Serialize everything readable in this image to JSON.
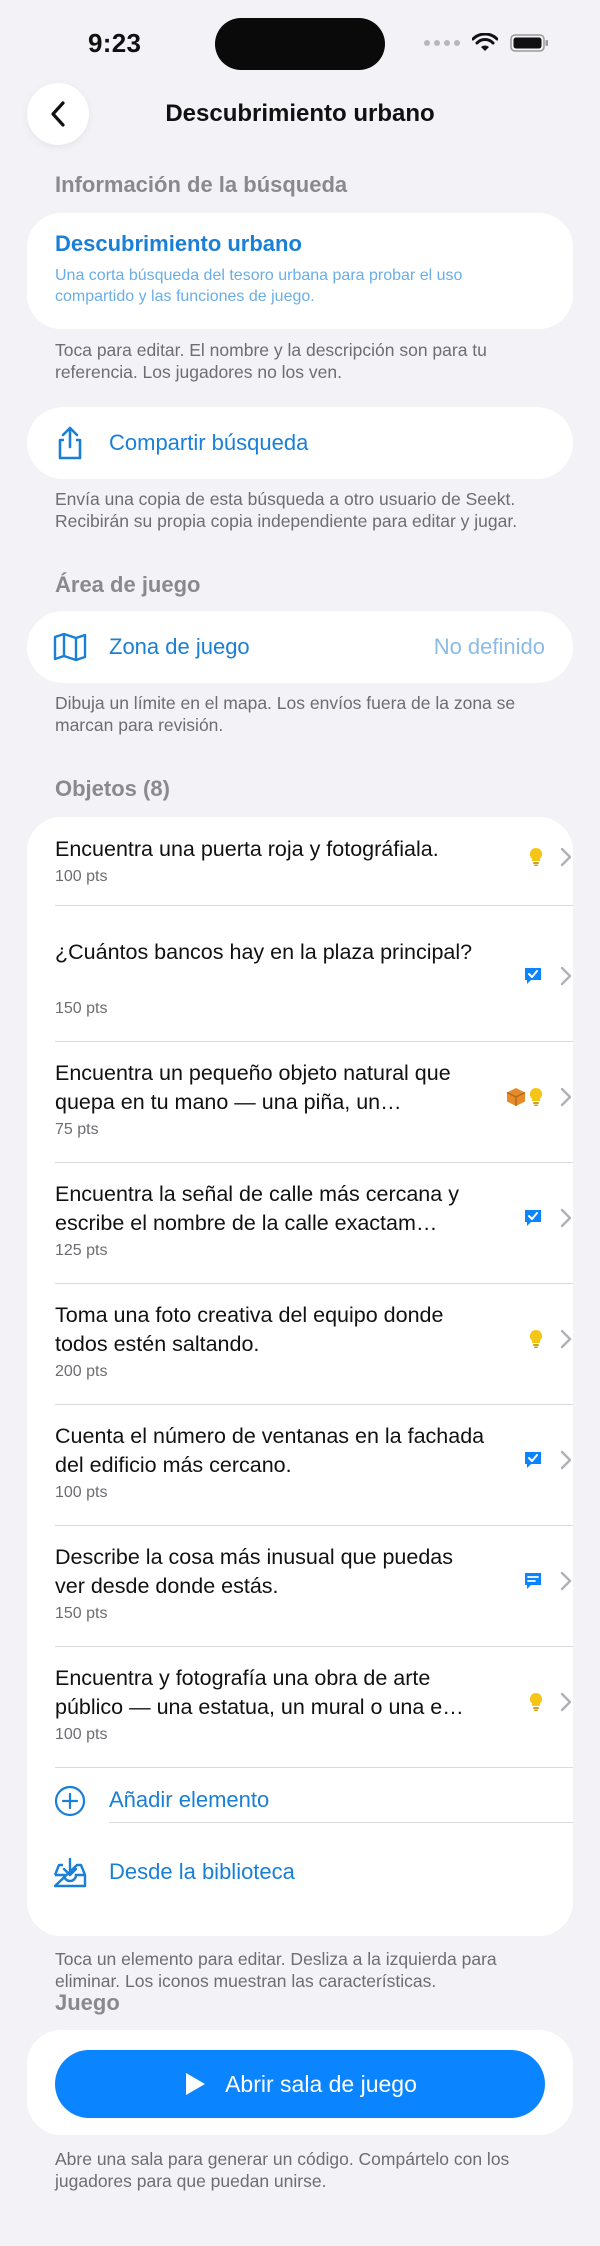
{
  "status": {
    "time": "9:23"
  },
  "nav": {
    "title": "Descubrimiento urbano"
  },
  "info_section": {
    "header": "Información de la búsqueda",
    "title": "Descubrimiento urbano",
    "description": "Una corta búsqueda del tesoro urbana para probar el uso compartido y las funciones de juego.",
    "footnote": "Toca para editar. El nombre y la descripción son para tu referencia. Los jugadores no los ven."
  },
  "share": {
    "label": "Compartir búsqueda",
    "footnote": "Envía una copia de esta búsqueda a otro usuario de Seekt. Recibirán su propia copia independiente para editar y jugar."
  },
  "area": {
    "header": "Área de juego",
    "label": "Zona de juego",
    "value": "No definido",
    "footnote": "Dibuja un límite en el mapa. Los envíos fuera de la zona se marcan para revisión."
  },
  "items_section": {
    "header": "Objetos (8)",
    "items": [
      {
        "text": "Encuentra una puerta roja y fotográfiala.",
        "points": "100 pts",
        "badges": [
          "lightbulb-icon"
        ]
      },
      {
        "text": "¿Cuántos bancos hay en la plaza principal?",
        "points": "150 pts",
        "badges": [
          "checkbox-chat-icon"
        ]
      },
      {
        "text": "Encuentra un pequeño objeto natural que quepa en tu mano — una piña, un…",
        "points": "75 pts",
        "badges": [
          "box-icon",
          "lightbulb-icon"
        ]
      },
      {
        "text": "Encuentra la señal de calle más cercana y escribe el nombre de la calle exactam…",
        "points": "125 pts",
        "badges": [
          "checkbox-chat-icon"
        ]
      },
      {
        "text": "Toma una foto creativa del equipo donde todos estén saltando.",
        "points": "200 pts",
        "badges": [
          "lightbulb-icon"
        ]
      },
      {
        "text": "Cuenta el número de ventanas en la fachada del edificio más cercano.",
        "points": "100 pts",
        "badges": [
          "checkbox-chat-icon"
        ]
      },
      {
        "text": "Describe la cosa más inusual que puedas ver desde donde estás.",
        "points": "150 pts",
        "badges": [
          "text-chat-icon"
        ]
      },
      {
        "text": "Encuentra y fotografía una obra de arte público — una estatua, un mural o una e…",
        "points": "100 pts",
        "badges": [
          "lightbulb-icon"
        ]
      }
    ],
    "add_label": "Añadir elemento",
    "library_label": "Desde la biblioteca",
    "footnote": "Toca un elemento para editar. Desliza a la izquierda para eliminar. Los iconos muestran las características."
  },
  "game": {
    "header": "Juego",
    "play_label": "Abrir sala de juego",
    "footnote": "Abre una sala para generar un código. Compártelo con los jugadores para que puedan unirse."
  },
  "colors": {
    "accent": "#1a7fd6",
    "primary_button": "#0a84ff",
    "background": "#f2f2f7"
  }
}
